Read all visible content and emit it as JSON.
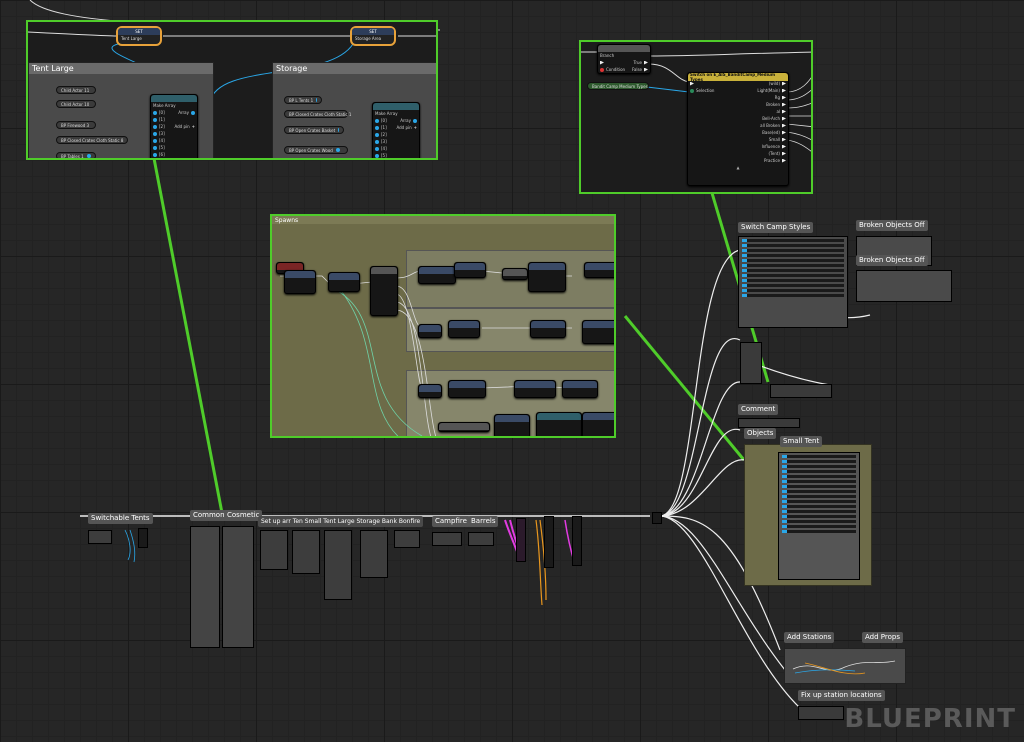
{
  "zoom_tent": {
    "set_nodes": [
      {
        "title": "SET",
        "pin": "Tent Large"
      },
      {
        "title": "SET",
        "pin": "Storage Area"
      }
    ],
    "comment_tent_large": "Tent Large",
    "comment_storage": "Storage",
    "tent_vars": [
      "Child Actor 11",
      "Child Actor 10",
      "BP Firewood 3",
      "BP Closed Crates Cloth Static 8",
      "BP Tables 1"
    ],
    "storage_vars": [
      "BP L Tents 1",
      "BP Closed Crates Cloth Static 1",
      "BP Open Crates Basket",
      "BP Open Crates Wood"
    ],
    "make_array": {
      "title": "Make Array",
      "array_pin": "Array",
      "add_pin": "Add pin",
      "indices_tent": [
        "[0]",
        "[1]",
        "[2]",
        "[3]",
        "[4]",
        "[5]",
        "[6]"
      ],
      "indices_storage": [
        "[0]",
        "[1]",
        "[2]",
        "[3]",
        "[4]",
        "[5]"
      ]
    }
  },
  "zoom_branch": {
    "branch": {
      "title": "Branch",
      "condition": "Condition",
      "true": "True",
      "false": "False"
    },
    "switch": {
      "title": "Switch on E_AIS_BanditCamp_Medium Types",
      "selection": "Selection",
      "outputs": [
        "(wild)",
        "Light(Main)",
        "Rg",
        "Broken",
        "al",
        "Bell-Arch",
        "all Broken",
        "Base(ed)",
        "Small",
        "Influence",
        "(Tent)",
        "Practice"
      ]
    },
    "var": "Bandit Camp Medium Types"
  },
  "zoom_center": {
    "title": "Spawns"
  },
  "comments": {
    "switchable_tents": "Switchable Tents",
    "common": "Common",
    "cosmetic": "Cosmetic",
    "setup_overlap": "Set up arr Ten Small Tent Large Storage Bank Bonfire",
    "campfire": "Campfire",
    "barrels": "Barrels",
    "switch_camp_styles": "Switch Camp Styles",
    "broken_objects_off_1": "Broken Objects Off",
    "broken_objects_off_2": "Broken Objects Off",
    "comment": "Comment",
    "objects": "Objects",
    "small_tent": "Small Tent",
    "add_stations": "Add Stations",
    "add_props": "Add Props",
    "fix_up_station_locations": "Fix up station locations"
  },
  "watermark": "BLUEPRINT",
  "colors": {
    "highlight": "#4fcc2a",
    "wire_white": "#ffffff",
    "pin_blue": "#2aa7e8",
    "set_border": "#e8a23a",
    "comment_olive": "#6d6b48"
  }
}
